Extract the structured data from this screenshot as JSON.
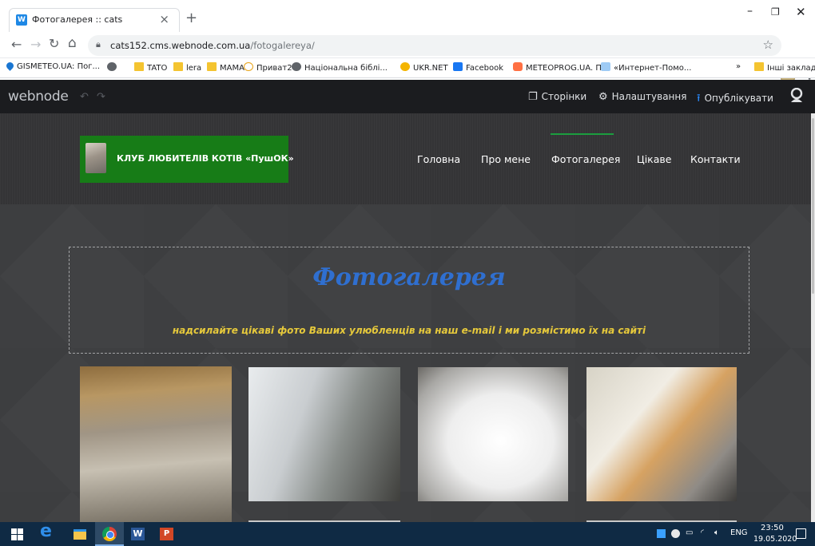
{
  "browser": {
    "tab_title": "Фотогалерея :: cats",
    "tab_favicon_letter": "W",
    "url_host": "cats152.cms.webnode.com.ua",
    "url_path": "/fotogalereya/",
    "bookmarks": [
      "GISMETEO.UA: Пог...",
      "TATO",
      "lera",
      "МАМА",
      "Приват24",
      "Національна біблі...",
      "UKR.NET",
      "Facebook",
      "METEOPROG.UA. П...",
      "«Интернет-Помо..."
    ],
    "bookmarks_overflow": "»",
    "other_bookmarks": "Інші закладки"
  },
  "editor": {
    "logo": "webnode",
    "pages_label": "Сторінки",
    "settings_label": "Налаштування",
    "publish_label": "Опублікувати"
  },
  "site": {
    "title": "КЛУБ ЛЮБИТЕЛІВ КОТІВ «ПушОК»",
    "nav": [
      "Головна",
      "Про мене",
      "Фотогалерея",
      "Цікаве",
      "Контакти"
    ],
    "active_nav": "Фотогалерея",
    "accent_color": "#1b9e3e"
  },
  "gallery": {
    "heading": "Фотогалерея",
    "subtitle": "надсилайте цікаві фото Ваших улюбленців на наш e-mail і ми розмістимо їх на сайті"
  },
  "taskbar": {
    "language": "ENG",
    "time": "23:50",
    "date": "19.05.2020"
  }
}
